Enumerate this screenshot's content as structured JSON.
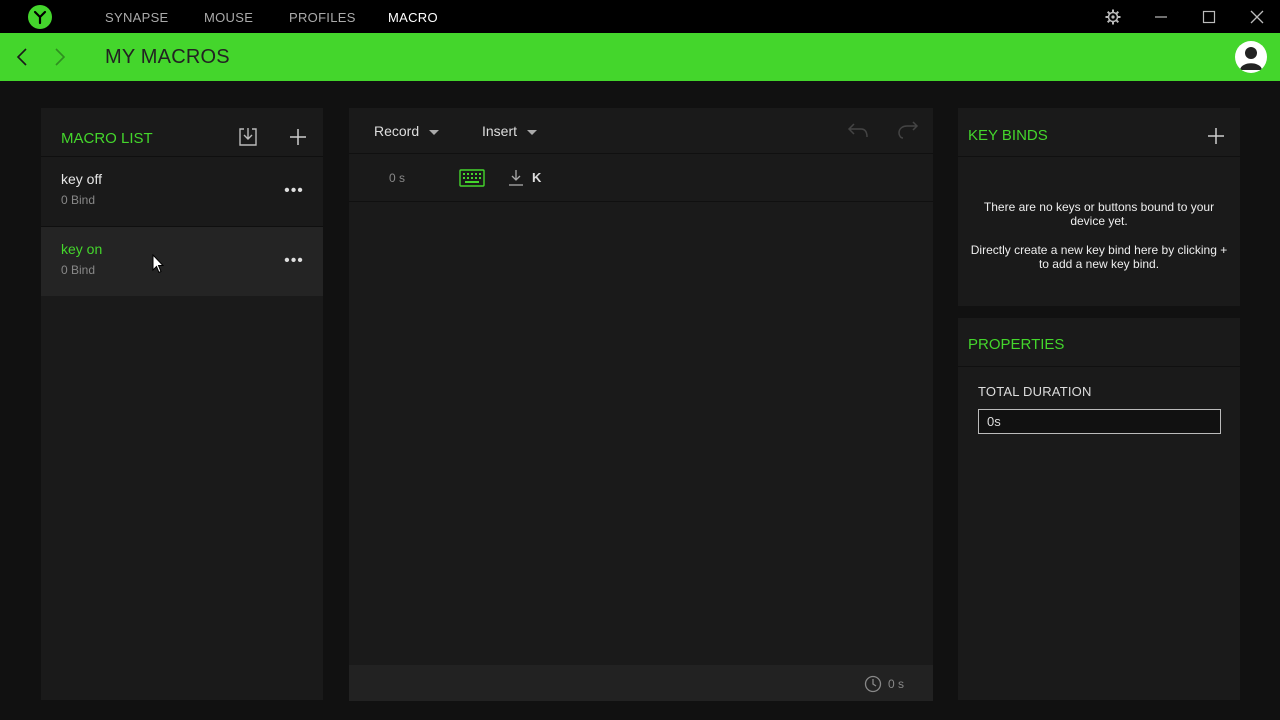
{
  "titlebar": {
    "tabs": [
      {
        "label": "SYNAPSE",
        "active": false
      },
      {
        "label": "MOUSE",
        "active": false
      },
      {
        "label": "PROFILES",
        "active": false
      },
      {
        "label": "MACRO",
        "active": true
      }
    ]
  },
  "header": {
    "title": "MY MACROS"
  },
  "macro_list": {
    "title": "MACRO LIST",
    "items": [
      {
        "name": "key off",
        "sub": "0 Bind",
        "selected": false
      },
      {
        "name": "key on",
        "sub": "0 Bind",
        "selected": true
      }
    ],
    "more_label": "•••"
  },
  "editor": {
    "record_label": "Record",
    "insert_label": "Insert",
    "events": [
      {
        "time": "0 s",
        "type": "keyboard-key-press",
        "key": "K"
      }
    ],
    "total_time": "0 s"
  },
  "key_binds": {
    "title": "KEY BINDS",
    "message_1": "There are no keys or buttons bound to your device yet.",
    "message_2": "Directly create a new key bind here by clicking + to add a new key bind."
  },
  "properties": {
    "title": "PROPERTIES",
    "duration_label": "TOTAL DURATION",
    "duration_value": "0s"
  },
  "colors": {
    "accent": "#44d62c",
    "background": "#111111",
    "panel": "#1a1a1a"
  }
}
